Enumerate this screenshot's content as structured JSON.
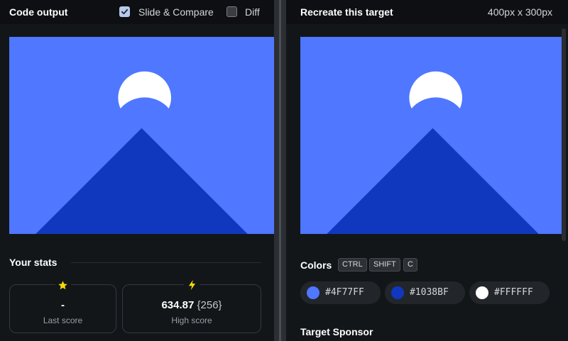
{
  "left_header": {
    "title": "Code output",
    "slide_compare": {
      "label": "Slide & Compare",
      "checked": true
    },
    "diff": {
      "label": "Diff",
      "checked": false
    }
  },
  "right_header": {
    "title": "Recreate this target",
    "dimensions": "400px x 300px"
  },
  "stats": {
    "title": "Your stats",
    "last_score": {
      "value": "-",
      "label": "Last score",
      "icon": "star-icon"
    },
    "high_score": {
      "value": "634.87",
      "sub": "{256}",
      "label": "High score",
      "icon": "lightning-icon"
    }
  },
  "colors": {
    "title": "Colors",
    "shortcut_keys": [
      "CTRL",
      "SHIFT",
      "C"
    ],
    "swatches": [
      {
        "hex": "#4F77FF",
        "color": "#4f77ff"
      },
      {
        "hex": "#1038BF",
        "color": "#1038bf"
      },
      {
        "hex": "#FFFFFF",
        "color": "#ffffff"
      }
    ]
  },
  "sponsor": {
    "title": "Target Sponsor"
  },
  "theme": {
    "background": "#4f77ff",
    "mountain": "#1038bf",
    "moon": "#ffffff",
    "star": "#f5d90a",
    "lightning": "#f5d90a"
  }
}
